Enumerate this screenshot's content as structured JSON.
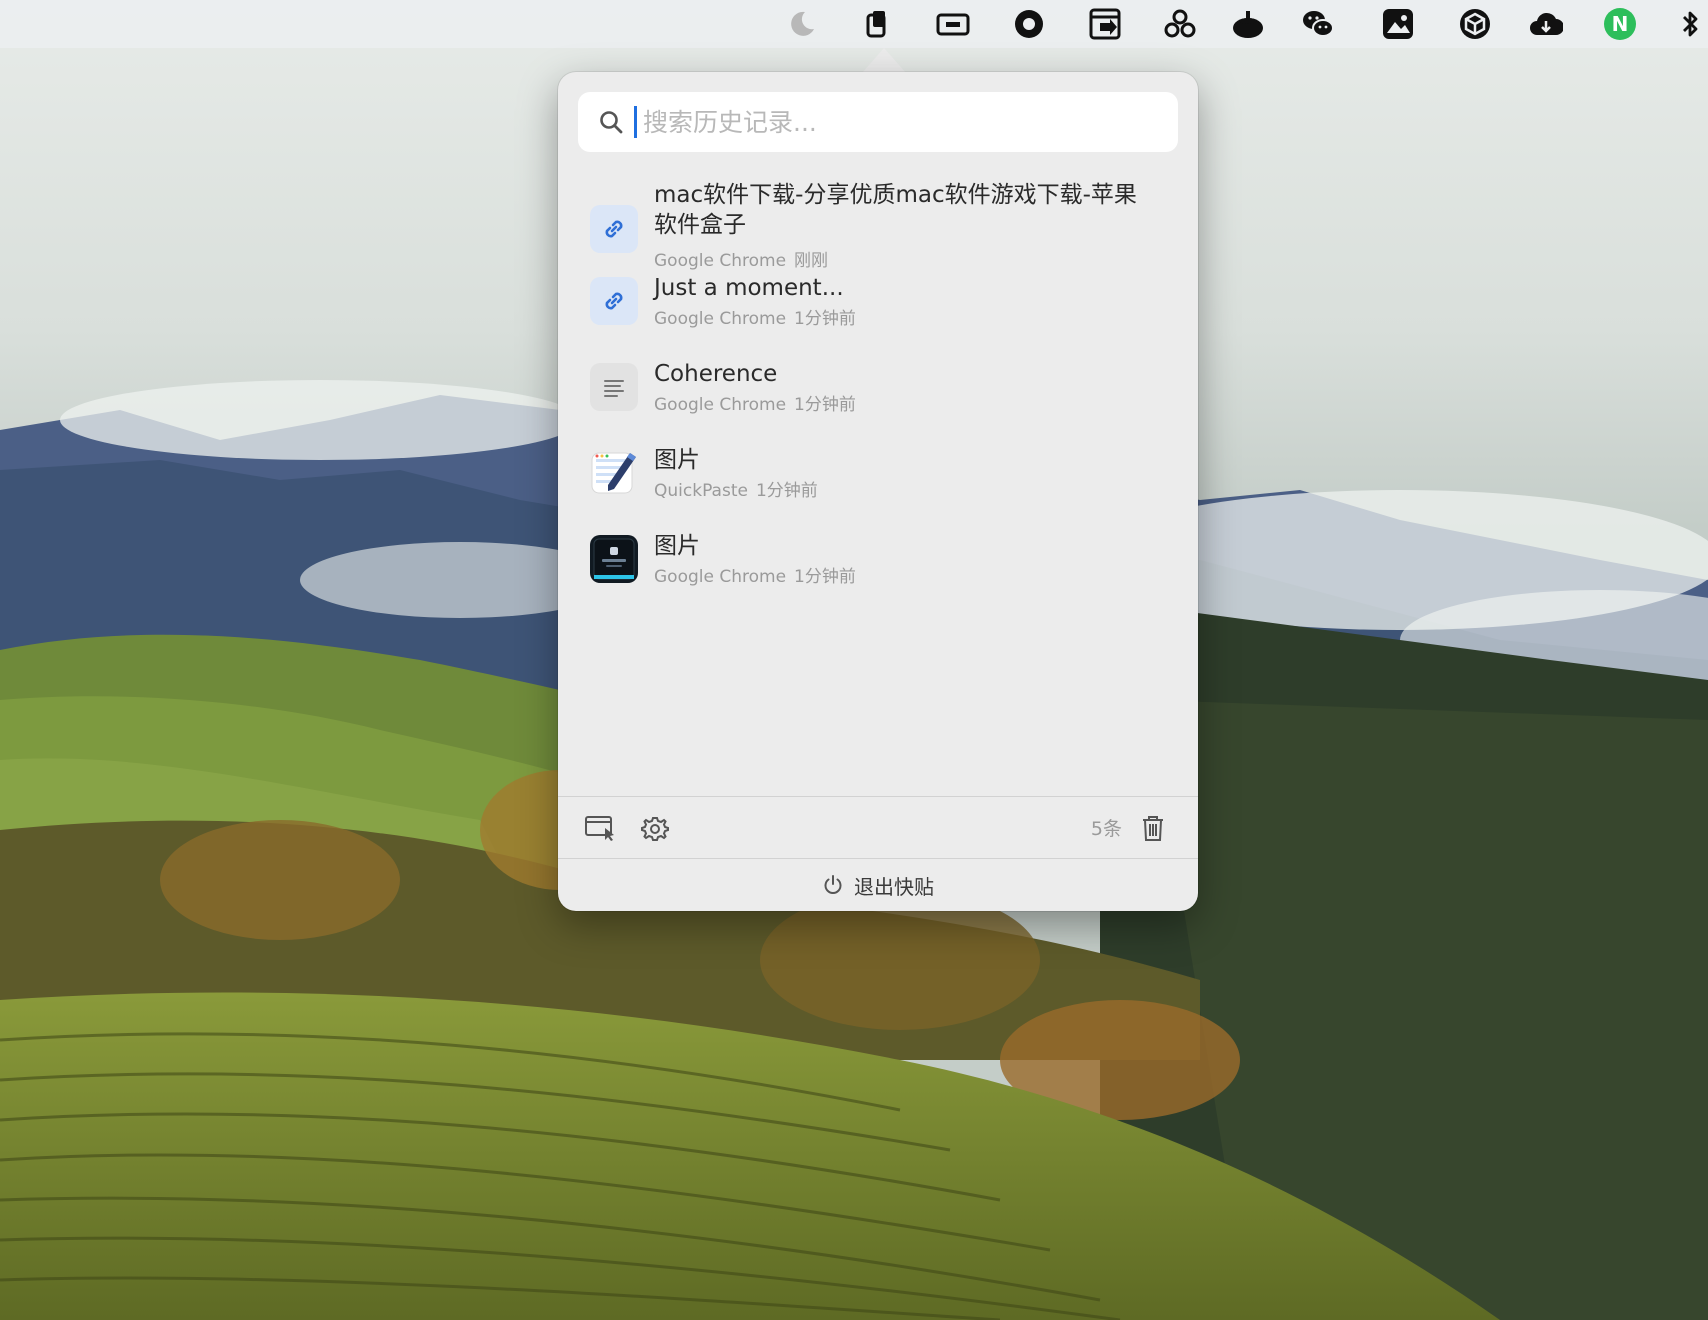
{
  "menubar": {
    "icons": [
      "moon-icon",
      "clipboard-icon",
      "screen-record-icon",
      "ring-icon",
      "window-arrow-icon",
      "cluster-icon",
      "bell-dome-icon",
      "wechat-icon",
      "photos-icon",
      "box-icon",
      "cloud-icon",
      "notion-icon",
      "bluetooth-icon"
    ],
    "notion_letter": "N",
    "accent_green": "#2dbe5b"
  },
  "popover": {
    "search": {
      "placeholder": "搜索历史记录..."
    },
    "items": [
      {
        "title": "mac软件下载-分享优质mac软件游戏下载-苹果软件盒子",
        "source": "Google Chrome",
        "time": "刚刚",
        "kind": "link",
        "icon": "link-icon"
      },
      {
        "title": "Just a moment...",
        "source": "Google Chrome",
        "time": "1分钟前",
        "kind": "link",
        "icon": "link-icon"
      },
      {
        "title": "Coherence",
        "source": "Google Chrome",
        "time": "1分钟前",
        "kind": "text",
        "icon": "text-lines-icon"
      },
      {
        "title": "图片",
        "source": "QuickPaste",
        "time": "1分钟前",
        "kind": "image",
        "icon": "quickpaste-app-icon"
      },
      {
        "title": "图片",
        "source": "Google Chrome",
        "time": "1分钟前",
        "kind": "image",
        "icon": "screenshot-thumbnail-icon"
      }
    ],
    "footer": {
      "count": "5条",
      "quit_label": "退出快贴",
      "icons": [
        "window-pointer-icon",
        "gear-icon",
        "trash-icon",
        "power-icon"
      ]
    },
    "colors": {
      "accent": "#1f6fe0",
      "link_bg": "#dbe6f7",
      "panel_bg": "#ececec"
    }
  }
}
